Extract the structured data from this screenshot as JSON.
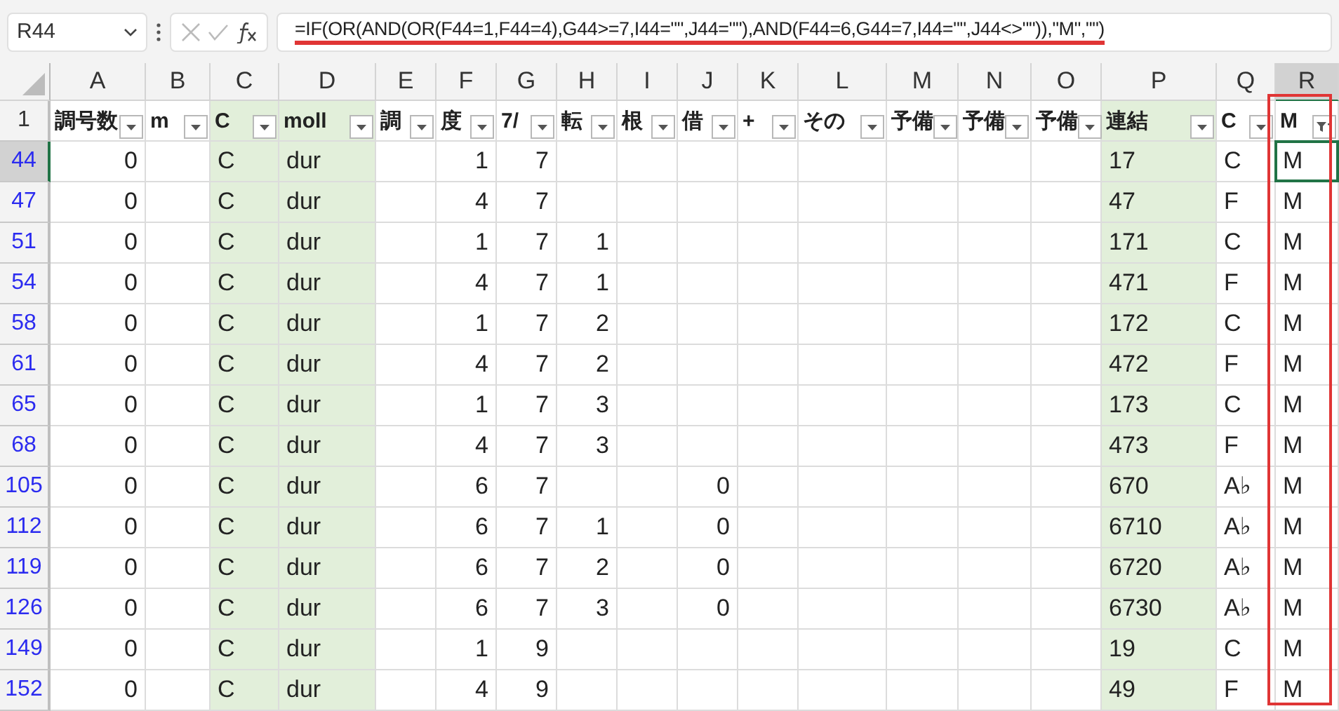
{
  "name_box": "R44",
  "formula": "=IF(OR(AND(OR(F44=1,F44=4),G44>=7,I44=\"\",J44=\"\"),AND(F44=6,G44=7,I44=\"\",J44<>\"\")),\"M\",\"\")",
  "columns": [
    {
      "letter": "A",
      "header": "調号数",
      "kind": "number",
      "shaded": false,
      "selected": false,
      "filtered": false
    },
    {
      "letter": "B",
      "header": "m",
      "kind": "text",
      "shaded": false,
      "selected": false,
      "filtered": false
    },
    {
      "letter": "C",
      "header": "C",
      "kind": "text",
      "shaded": true,
      "selected": false,
      "filtered": false
    },
    {
      "letter": "D",
      "header": "moll",
      "kind": "text",
      "shaded": true,
      "selected": false,
      "filtered": false
    },
    {
      "letter": "E",
      "header": "調",
      "kind": "text",
      "shaded": false,
      "selected": false,
      "filtered": false
    },
    {
      "letter": "F",
      "header": "度",
      "kind": "number",
      "shaded": false,
      "selected": false,
      "filtered": false
    },
    {
      "letter": "G",
      "header": "7/",
      "kind": "number",
      "shaded": false,
      "selected": false,
      "filtered": false
    },
    {
      "letter": "H",
      "header": "転",
      "kind": "number",
      "shaded": false,
      "selected": false,
      "filtered": false
    },
    {
      "letter": "I",
      "header": "根",
      "kind": "number",
      "shaded": false,
      "selected": false,
      "filtered": false
    },
    {
      "letter": "J",
      "header": "借",
      "kind": "number",
      "shaded": false,
      "selected": false,
      "filtered": false
    },
    {
      "letter": "K",
      "header": "+",
      "kind": "text",
      "shaded": false,
      "selected": false,
      "filtered": false
    },
    {
      "letter": "L",
      "header": "その",
      "kind": "text",
      "shaded": false,
      "selected": false,
      "filtered": false
    },
    {
      "letter": "M",
      "header": "予備",
      "kind": "text",
      "shaded": false,
      "selected": false,
      "filtered": false
    },
    {
      "letter": "N",
      "header": "予備",
      "kind": "text",
      "shaded": false,
      "selected": false,
      "filtered": false
    },
    {
      "letter": "O",
      "header": "予備",
      "kind": "text",
      "shaded": false,
      "selected": false,
      "filtered": false
    },
    {
      "letter": "P",
      "header": "連結",
      "kind": "text",
      "shaded": true,
      "selected": false,
      "filtered": false
    },
    {
      "letter": "Q",
      "header": "C",
      "kind": "text",
      "shaded": false,
      "selected": false,
      "filtered": false
    },
    {
      "letter": "R",
      "header": "M",
      "kind": "text",
      "shaded": false,
      "selected": true,
      "filtered": true
    }
  ],
  "header_row": "1",
  "rows": [
    {
      "number": "44",
      "selected": true,
      "cells": [
        "0",
        "",
        "C",
        "dur",
        "",
        "1",
        "7",
        "",
        "",
        "",
        "",
        "",
        "",
        "",
        "",
        "17",
        "C",
        "M"
      ]
    },
    {
      "number": "47",
      "selected": false,
      "cells": [
        "0",
        "",
        "C",
        "dur",
        "",
        "4",
        "7",
        "",
        "",
        "",
        "",
        "",
        "",
        "",
        "",
        "47",
        "F",
        "M"
      ]
    },
    {
      "number": "51",
      "selected": false,
      "cells": [
        "0",
        "",
        "C",
        "dur",
        "",
        "1",
        "7",
        "1",
        "",
        "",
        "",
        "",
        "",
        "",
        "",
        "171",
        "C",
        "M"
      ]
    },
    {
      "number": "54",
      "selected": false,
      "cells": [
        "0",
        "",
        "C",
        "dur",
        "",
        "4",
        "7",
        "1",
        "",
        "",
        "",
        "",
        "",
        "",
        "",
        "471",
        "F",
        "M"
      ]
    },
    {
      "number": "58",
      "selected": false,
      "cells": [
        "0",
        "",
        "C",
        "dur",
        "",
        "1",
        "7",
        "2",
        "",
        "",
        "",
        "",
        "",
        "",
        "",
        "172",
        "C",
        "M"
      ]
    },
    {
      "number": "61",
      "selected": false,
      "cells": [
        "0",
        "",
        "C",
        "dur",
        "",
        "4",
        "7",
        "2",
        "",
        "",
        "",
        "",
        "",
        "",
        "",
        "472",
        "F",
        "M"
      ]
    },
    {
      "number": "65",
      "selected": false,
      "cells": [
        "0",
        "",
        "C",
        "dur",
        "",
        "1",
        "7",
        "3",
        "",
        "",
        "",
        "",
        "",
        "",
        "",
        "173",
        "C",
        "M"
      ]
    },
    {
      "number": "68",
      "selected": false,
      "cells": [
        "0",
        "",
        "C",
        "dur",
        "",
        "4",
        "7",
        "3",
        "",
        "",
        "",
        "",
        "",
        "",
        "",
        "473",
        "F",
        "M"
      ]
    },
    {
      "number": "105",
      "selected": false,
      "cells": [
        "0",
        "",
        "C",
        "dur",
        "",
        "6",
        "7",
        "",
        "",
        "0",
        "",
        "",
        "",
        "",
        "",
        "670",
        "A♭",
        "M"
      ]
    },
    {
      "number": "112",
      "selected": false,
      "cells": [
        "0",
        "",
        "C",
        "dur",
        "",
        "6",
        "7",
        "1",
        "",
        "0",
        "",
        "",
        "",
        "",
        "",
        "6710",
        "A♭",
        "M"
      ]
    },
    {
      "number": "119",
      "selected": false,
      "cells": [
        "0",
        "",
        "C",
        "dur",
        "",
        "6",
        "7",
        "2",
        "",
        "0",
        "",
        "",
        "",
        "",
        "",
        "6720",
        "A♭",
        "M"
      ]
    },
    {
      "number": "126",
      "selected": false,
      "cells": [
        "0",
        "",
        "C",
        "dur",
        "",
        "6",
        "7",
        "3",
        "",
        "0",
        "",
        "",
        "",
        "",
        "",
        "6730",
        "A♭",
        "M"
      ]
    },
    {
      "number": "149",
      "selected": false,
      "cells": [
        "0",
        "",
        "C",
        "dur",
        "",
        "1",
        "9",
        "",
        "",
        "",
        "",
        "",
        "",
        "",
        "",
        "19",
        "C",
        "M"
      ]
    },
    {
      "number": "152",
      "selected": false,
      "cells": [
        "0",
        "",
        "C",
        "dur",
        "",
        "4",
        "9",
        "",
        "",
        "",
        "",
        "",
        "",
        "",
        "",
        "49",
        "F",
        "M"
      ]
    }
  ]
}
